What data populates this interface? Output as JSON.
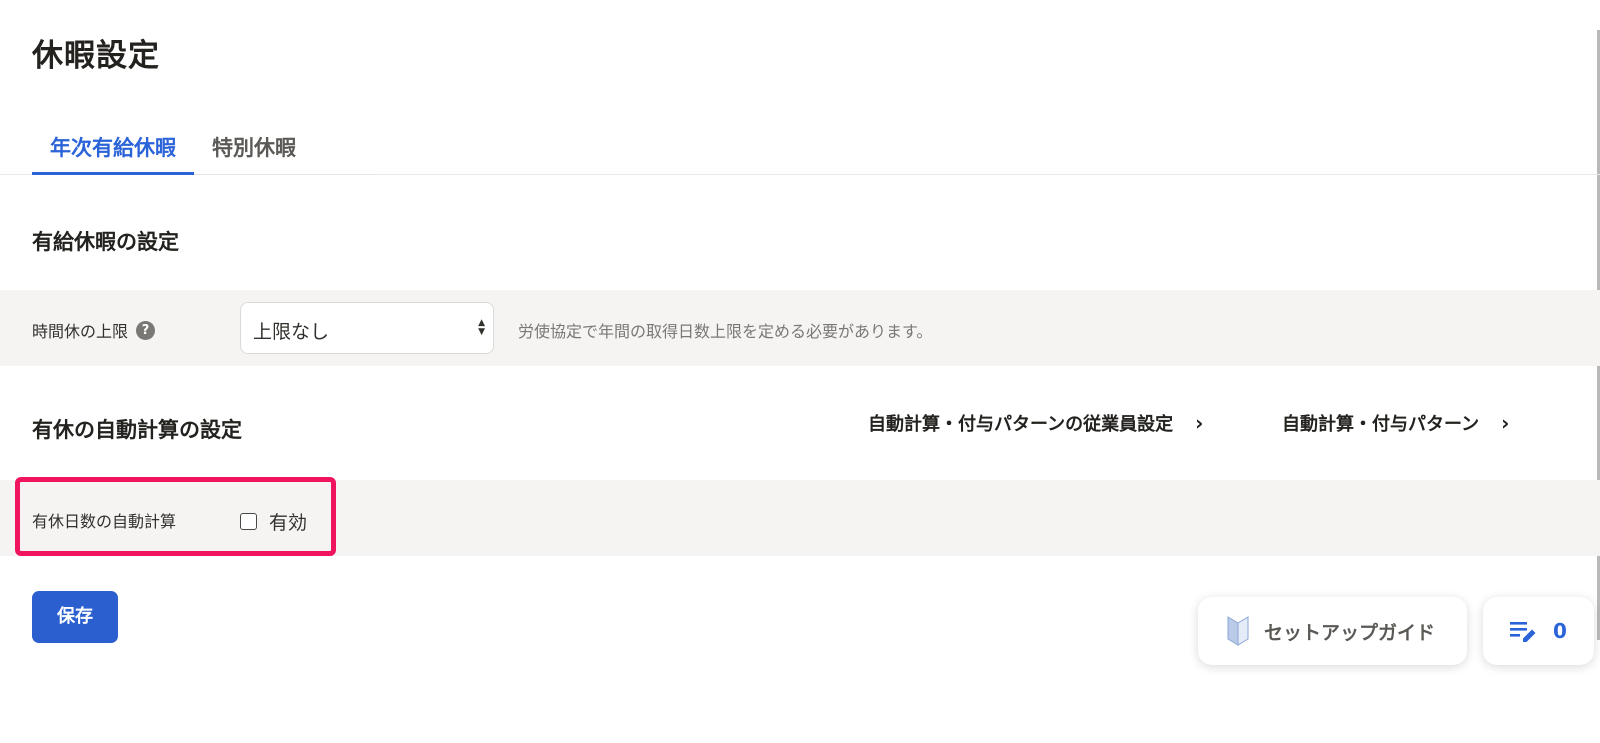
{
  "page": {
    "title": "休暇設定"
  },
  "tabs": [
    {
      "label": "年次有給休暇",
      "active": true
    },
    {
      "label": "特別休暇",
      "active": false
    }
  ],
  "paid_leave_section": {
    "title": "有給休暇の設定",
    "hourly_limit": {
      "label": "時間休の上限",
      "help_icon": "?",
      "selected": "上限なし",
      "hint": "労使協定で年間の取得日数上限を定める必要があります。"
    }
  },
  "auto_calc_section": {
    "title": "有休の自動計算の設定",
    "links": [
      {
        "label": "自動計算・付与パターンの従業員設定",
        "chevron": "›"
      },
      {
        "label": "自動計算・付与パターン",
        "chevron": "›"
      }
    ],
    "auto_calc_row": {
      "label": "有休日数の自動計算",
      "checkbox_label": "有効",
      "checked": false
    }
  },
  "actions": {
    "save_label": "保存"
  },
  "floating": {
    "guide_label": "セットアップガイド",
    "todo_count": "0"
  },
  "colors": {
    "accent": "#2b63d9",
    "highlight": "#f0135e",
    "row_bg": "#f6f4f3"
  }
}
